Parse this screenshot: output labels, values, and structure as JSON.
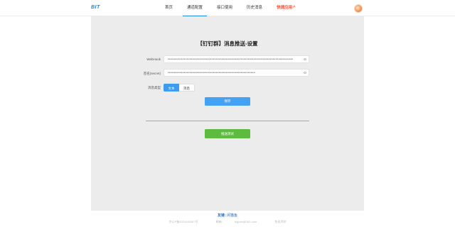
{
  "header": {
    "logo": "BIT",
    "nav": [
      {
        "label": "首页",
        "active": false
      },
      {
        "label": "通道配置",
        "active": true
      },
      {
        "label": "接口使用",
        "active": false
      },
      {
        "label": "历史消息",
        "active": false
      },
      {
        "label": "快捷应用",
        "active": false,
        "chevron": "^"
      }
    ]
  },
  "form": {
    "title": "【钉钉群】消息推送-设置",
    "webhook_label": "WebHook",
    "webhook_value": "••••••••••••••••••••••••••••••••••••••••••••••••••••••••••••••••••••••••••••••••••••••",
    "secret_label": "签名(secret)",
    "secret_value": "••••••••••••••••••••••••••••••••••••••••••••••••••••••••••••",
    "type_label": "消息类型",
    "type_options": [
      "文本",
      "消息"
    ],
    "selected_type": "文本",
    "save_label": "保存",
    "test_label": "推送测试"
  },
  "footer": {
    "friends_label": "友链:",
    "friends_link": "闲猫鱼",
    "icp": "京ICP备2021045467号",
    "email_label": "邮箱:",
    "email": "bigrain@163.com",
    "disclaimer": "免责声明"
  },
  "colors": {
    "accent": "#1e88e5",
    "primary_button": "#44a2f5",
    "success_button": "#5dbb3f",
    "hot_nav": "#ff4d2d"
  }
}
